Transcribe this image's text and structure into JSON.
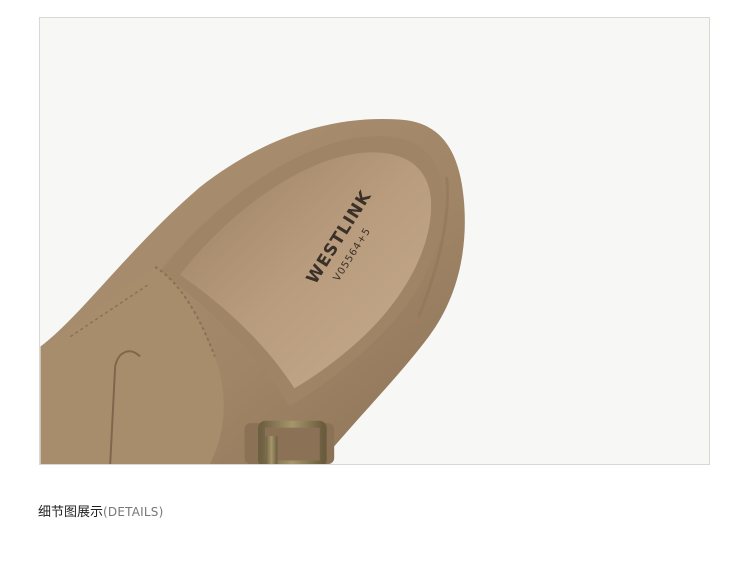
{
  "product_image": {
    "insole_brand": "WESTLINK",
    "insole_code": "V05564+5",
    "colors": {
      "suede": "#a48a6c",
      "suede_dark": "#8a7156",
      "insole": "#b89b7c",
      "buckle": "#8b7a55",
      "background": "#f7f7f6"
    }
  },
  "caption": {
    "title_cn": "细节图展示",
    "title_en": "(DETAILS)"
  }
}
